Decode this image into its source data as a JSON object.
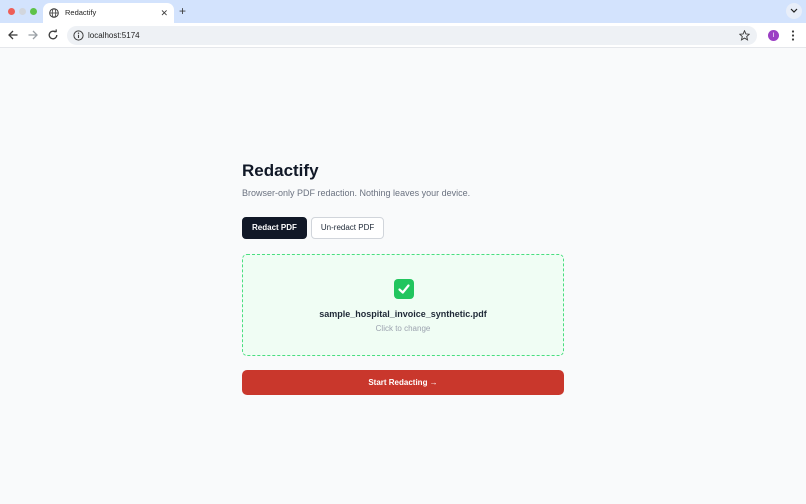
{
  "browser": {
    "tab_title": "Redactify",
    "tab_close": "✕",
    "new_tab": "+",
    "url": "localhost:5174",
    "avatar_letter": "I"
  },
  "page": {
    "title": "Redactify",
    "subtitle": "Browser-only PDF redaction. Nothing leaves your device.",
    "modes": [
      {
        "label": "Redact PDF",
        "active": true
      },
      {
        "label": "Un-redact PDF",
        "active": false
      }
    ],
    "dropzone": {
      "file_name": "sample_hospital_invoice_synthetic.pdf",
      "hint": "Click to change",
      "status_icon": "check-mark-icon"
    },
    "start_button": "Start Redacting →"
  },
  "colors": {
    "primary_dark": "#111827",
    "accent_red": "#c9372c",
    "success_green": "#22c55e",
    "tab_bar": "#d3e3fd"
  }
}
